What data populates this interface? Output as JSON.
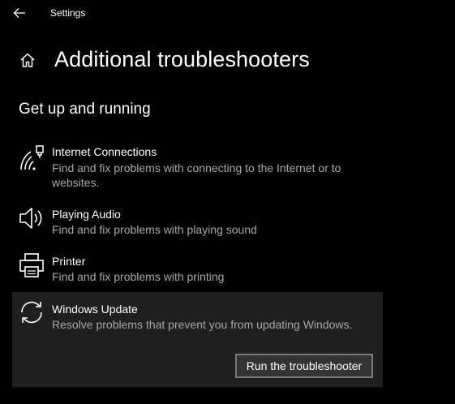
{
  "window": {
    "app_title": "Settings"
  },
  "header": {
    "page_title": "Additional troubleshooters"
  },
  "section": {
    "title": "Get up and running"
  },
  "troubleshooters": [
    {
      "name": "Internet Connections",
      "description": "Find and fix problems with connecting to the Internet or to websites.",
      "icon": "wifi-network-icon"
    },
    {
      "name": "Playing Audio",
      "description": "Find and fix problems with playing sound",
      "icon": "speaker-icon"
    },
    {
      "name": "Printer",
      "description": "Find and fix problems with printing",
      "icon": "printer-icon"
    },
    {
      "name": "Windows Update",
      "description": "Resolve problems that prevent you from updating Windows.",
      "icon": "sync-icon",
      "selected": true,
      "action_label": "Run the troubleshooter"
    }
  ],
  "colors": {
    "background": "#000000",
    "text_primary": "#ffffff",
    "text_secondary": "#a6a6a6",
    "selected_bg": "#1f1f1f",
    "button_bg": "#333333",
    "button_border": "#7a7a7a"
  }
}
